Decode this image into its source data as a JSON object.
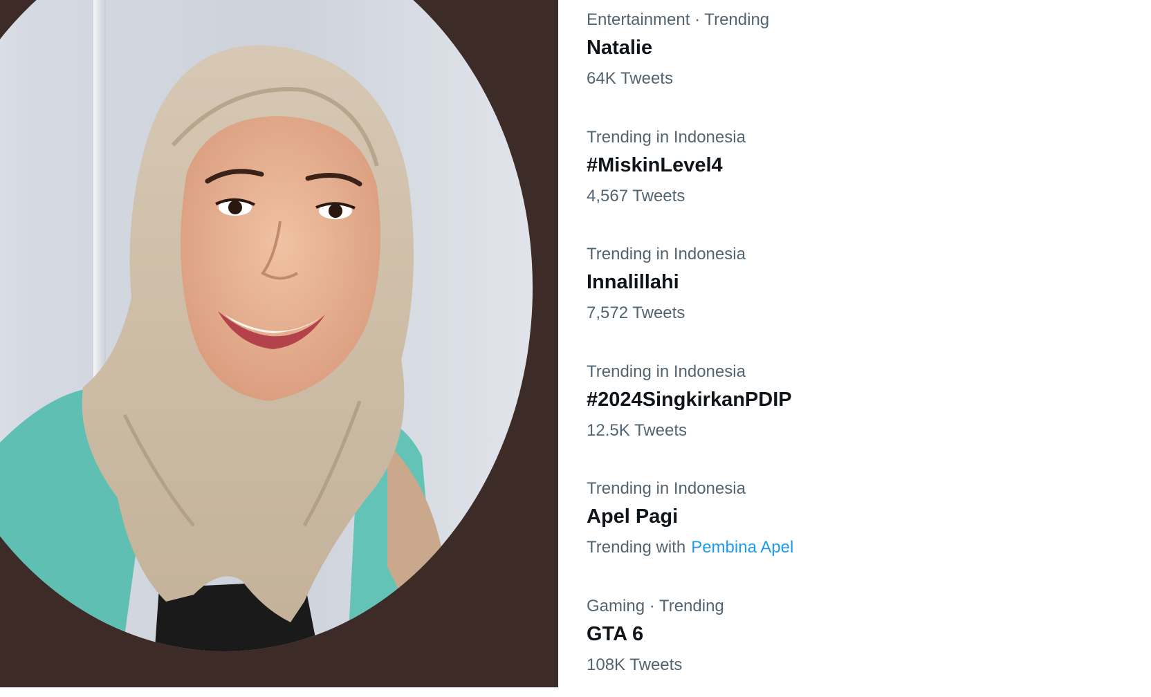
{
  "colors": {
    "panel_background": "#3d2b27",
    "meta_text": "#536471",
    "name_text": "#0f1419",
    "link": "#1d9bf0"
  },
  "trends": [
    {
      "meta": "Entertainment · Trending",
      "name": "Natalie",
      "count": "64K Tweets"
    },
    {
      "meta": "Trending in Indonesia",
      "name": "#MiskinLevel4",
      "count": "4,567 Tweets"
    },
    {
      "meta": "Trending in Indonesia",
      "name": "Innalillahi",
      "count": "7,572 Tweets"
    },
    {
      "meta": "Trending in Indonesia",
      "name": "#2024SingkirkanPDIP",
      "count": "12.5K Tweets"
    },
    {
      "meta": "Trending in Indonesia",
      "name": "Apel Pagi",
      "count_prefix": "Trending with",
      "count_link": "Pembina Apel"
    },
    {
      "meta": "Gaming · Trending",
      "name": "GTA 6",
      "count": "108K Tweets"
    }
  ]
}
